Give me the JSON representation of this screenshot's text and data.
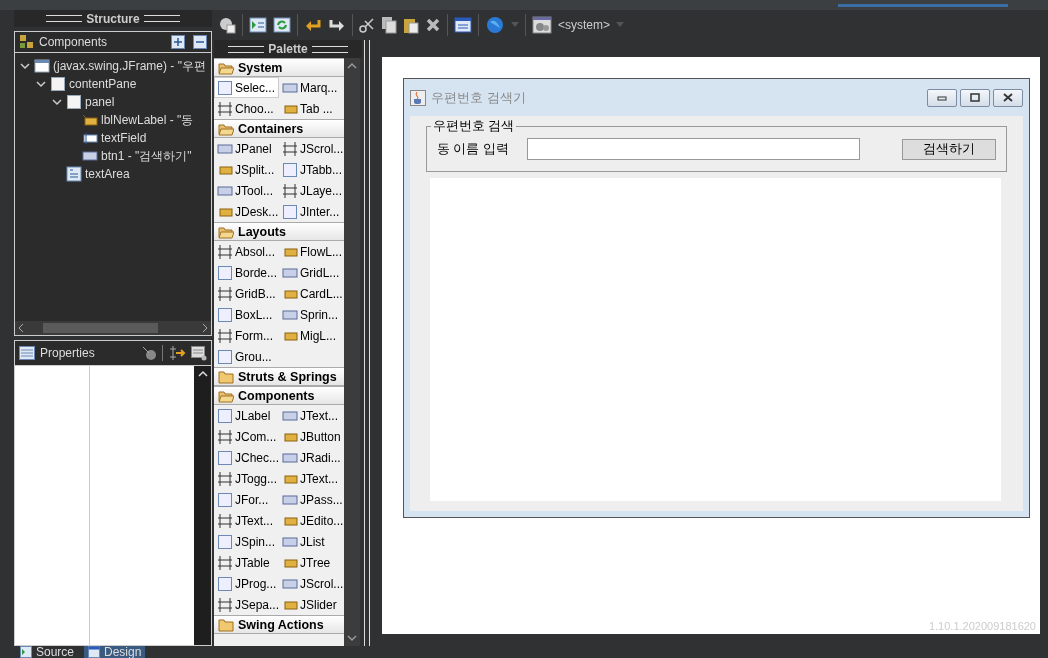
{
  "structure": {
    "title": "Structure",
    "components_title": "Components",
    "tree": [
      {
        "label": "(javax.swing.JFrame) - \"우편",
        "kind": "frame",
        "expanded": true,
        "children": [
          {
            "label": "contentPane",
            "kind": "panel",
            "expanded": true,
            "children": [
              {
                "label": "panel",
                "kind": "panel",
                "expanded": true,
                "children": [
                  {
                    "label": "lblNewLabel - \"동",
                    "kind": "label"
                  },
                  {
                    "label": "textField",
                    "kind": "field"
                  },
                  {
                    "label": "btn1 - \"검색하기\"",
                    "kind": "button"
                  }
                ]
              },
              {
                "label": "textArea",
                "kind": "area"
              }
            ]
          }
        ]
      }
    ]
  },
  "properties": {
    "title": "Properties"
  },
  "toolbar": {
    "system_label": "<system>"
  },
  "palette": {
    "title": "Palette",
    "groups": [
      {
        "name": "System",
        "expanded": true,
        "items": [
          {
            "label": "Selec...",
            "selected": true
          },
          {
            "label": "Marq...",
            "selected": false
          },
          {
            "label": "Choo...",
            "selected": false
          },
          {
            "label": "Tab ...",
            "selected": false
          }
        ]
      },
      {
        "name": "Containers",
        "expanded": true,
        "items": [
          {
            "label": "JPanel",
            "selected": false
          },
          {
            "label": "JScrol...",
            "selected": false
          },
          {
            "label": "JSplit...",
            "selected": false
          },
          {
            "label": "JTabb...",
            "selected": false
          },
          {
            "label": "JTool...",
            "selected": false
          },
          {
            "label": "JLaye...",
            "selected": false
          },
          {
            "label": "JDesk...",
            "selected": false
          },
          {
            "label": "JInter...",
            "selected": false
          }
        ]
      },
      {
        "name": "Layouts",
        "expanded": true,
        "items": [
          {
            "label": "Absol...",
            "selected": false
          },
          {
            "label": "FlowL...",
            "selected": false
          },
          {
            "label": "Borde...",
            "selected": false
          },
          {
            "label": "GridL...",
            "selected": false
          },
          {
            "label": "GridB...",
            "selected": false
          },
          {
            "label": "CardL...",
            "selected": false
          },
          {
            "label": "BoxL...",
            "selected": false
          },
          {
            "label": "Sprin...",
            "selected": false
          },
          {
            "label": "Form...",
            "selected": false
          },
          {
            "label": "MigL...",
            "selected": false
          },
          {
            "label": "Grou...",
            "selected": false
          }
        ]
      },
      {
        "name": "Struts & Springs",
        "expanded": false
      },
      {
        "name": "Components",
        "expanded": true,
        "items": [
          {
            "label": "JLabel",
            "selected": false
          },
          {
            "label": "JText...",
            "selected": false
          },
          {
            "label": "JCom...",
            "selected": false
          },
          {
            "label": "JButton",
            "selected": false
          },
          {
            "label": "JChec...",
            "selected": false
          },
          {
            "label": "JRadi...",
            "selected": false
          },
          {
            "label": "JTogg...",
            "selected": false
          },
          {
            "label": "JText...",
            "selected": false
          },
          {
            "label": "JFor...",
            "selected": false
          },
          {
            "label": "JPass...",
            "selected": false
          },
          {
            "label": "JText...",
            "selected": false
          },
          {
            "label": "JEdito...",
            "selected": false
          },
          {
            "label": "JSpin...",
            "selected": false
          },
          {
            "label": "JList",
            "selected": false
          },
          {
            "label": "JTable",
            "selected": false
          },
          {
            "label": "JTree",
            "selected": false
          },
          {
            "label": "JProg...",
            "selected": false
          },
          {
            "label": "JScrol...",
            "selected": false
          },
          {
            "label": "JSepa...",
            "selected": false
          },
          {
            "label": "JSlider",
            "selected": false
          }
        ]
      },
      {
        "name": "Swing Actions",
        "expanded": false
      }
    ]
  },
  "design": {
    "frame_title": "우편번호 검색기",
    "group_title": "우편번호 검색",
    "field_label": "동 이름 입력",
    "button": "검색하기",
    "version": "1.10.1.202009181620"
  },
  "bottom_tabs": [
    {
      "label": "Source",
      "selected": false
    },
    {
      "label": "Design",
      "selected": true
    }
  ]
}
